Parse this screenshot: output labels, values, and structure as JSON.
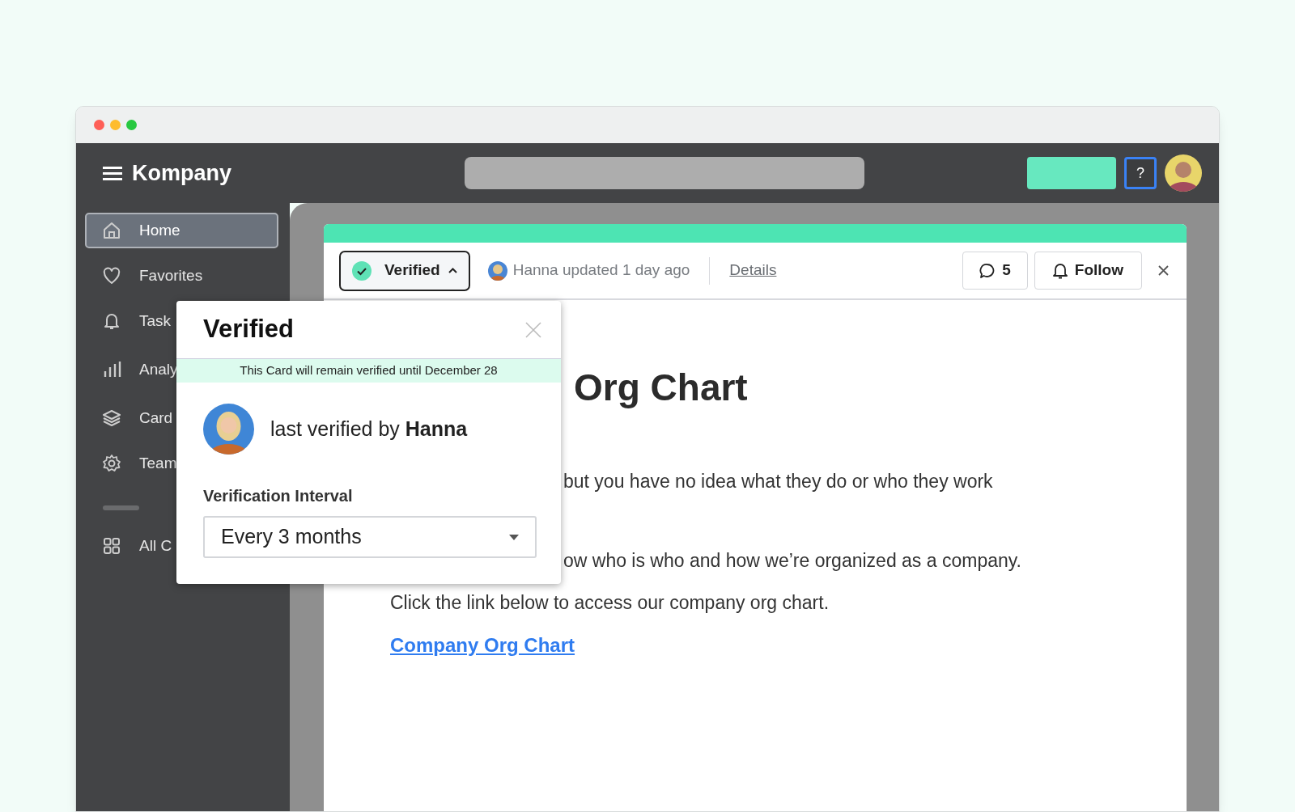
{
  "window": {
    "controls": [
      {
        "color": "#fe5f57"
      },
      {
        "color": "#febc2e"
      },
      {
        "color": "#28c840"
      }
    ]
  },
  "header": {
    "brand": "Kompany",
    "help": "?"
  },
  "sidebar": {
    "items": [
      {
        "label": "Home",
        "kind": "home",
        "selected": true
      },
      {
        "label": "Favorites",
        "kind": "heart",
        "selected": false
      },
      {
        "label": "Task",
        "kind": "bell",
        "selected": false
      },
      {
        "label": "Analy",
        "kind": "chart",
        "selected": false
      },
      {
        "label": "Card",
        "kind": "layers",
        "selected": false
      },
      {
        "label": "Team",
        "kind": "gear",
        "selected": false
      },
      {
        "label": "All C",
        "kind": "grid",
        "selected": false
      }
    ]
  },
  "card": {
    "status": {
      "label": "Verified",
      "expanded": true
    },
    "update": "Hanna updated 1 day ago",
    "details": "Details",
    "comments": "5",
    "follow": "Follow",
    "heading": "Org Chart",
    "paragraph_1": "but you have no idea what they do or who they work",
    "paragraph_2": [
      "ow who is who and how we’re organized as a company.",
      "Click the link below to access our company org chart."
    ],
    "link": "Company Org Chart"
  },
  "popover": {
    "title": "Verified",
    "banner": "This Card will remain verified until December 28",
    "verifier": "last verified by **Hanna**",
    "interval_label": "Verification Interval",
    "interval_value": "Every 3 months"
  }
}
